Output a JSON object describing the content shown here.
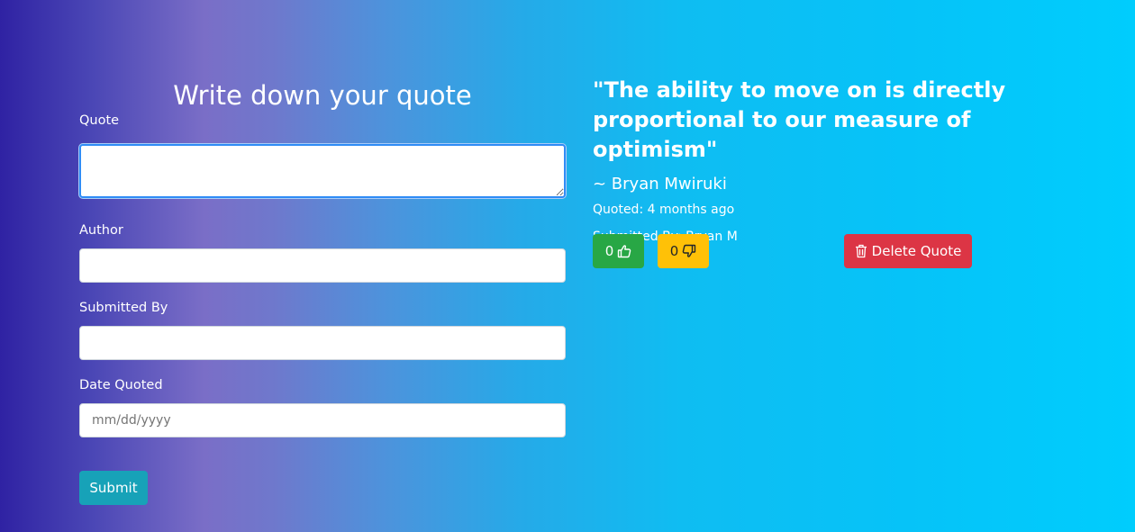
{
  "form": {
    "title": "Write down your quote",
    "quote_label": "Quote",
    "quote_value": "",
    "author_label": "Author",
    "author_value": "",
    "submitted_by_label": "Submitted By",
    "submitted_by_value": "",
    "date_label": "Date Quoted",
    "date_placeholder": "mm/dd/yyyy",
    "submit_label": "Submit"
  },
  "quote": {
    "text": "\"The ability to move on is directly proportional to our measure of optimism\"",
    "author": "~ Bryan Mwiruki",
    "quoted": "Quoted: 4 months ago",
    "submitted_by": "Submitted By: Bryan M",
    "upvotes": "0",
    "downvotes": "0",
    "delete_label": "Delete Quote"
  },
  "colors": {
    "upvote": "#28a745",
    "downvote": "#ffc107",
    "delete": "#dc3545",
    "submit": "#17a2b8"
  },
  "icons": {
    "upvote": "thumbs-up-icon",
    "downvote": "thumbs-down-icon",
    "delete": "trash-icon"
  }
}
